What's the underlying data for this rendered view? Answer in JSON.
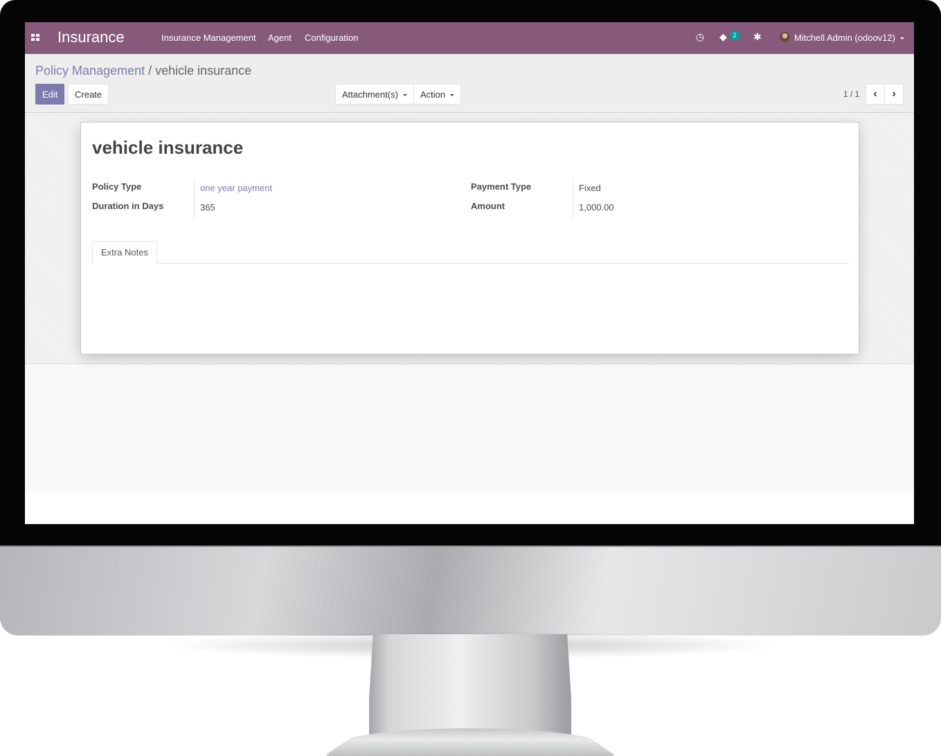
{
  "navbar": {
    "brand": "Insurance",
    "menu": [
      "Insurance Management",
      "Agent",
      "Configuration"
    ],
    "chat_count": "2",
    "user": "Mitchell Admin (odoov12)",
    "color": "#875a7b"
  },
  "breadcrumb": {
    "parent": "Policy Management",
    "separator": " / ",
    "current": "vehicle insurance"
  },
  "toolbar": {
    "edit_label": "Edit",
    "create_label": "Create",
    "attachments_label": "Attachment(s)",
    "action_label": "Action",
    "pager": "1 / 1",
    "prev_icon": "chevron-left-icon",
    "next_icon": "chevron-right-icon"
  },
  "record": {
    "title": "vehicle insurance",
    "fields": {
      "policy_type_label": "Policy Type",
      "policy_type_value": "one year payment",
      "duration_label": "Duration in Days",
      "duration_value": "365",
      "payment_type_label": "Payment Type",
      "payment_type_value": "Fixed",
      "amount_label": "Amount",
      "amount_value": "1,000.00"
    },
    "tabs": [
      "Extra Notes"
    ]
  },
  "colors": {
    "primary": "#7c7bad",
    "brand": "#875a7b",
    "badge": "#00a09d"
  }
}
